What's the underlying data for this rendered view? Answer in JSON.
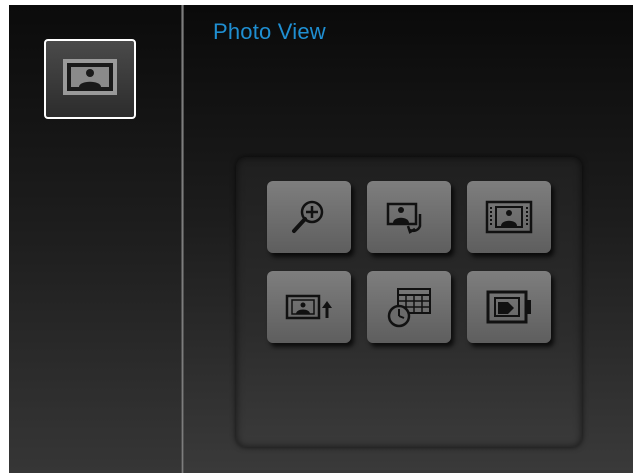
{
  "header": {
    "title": "Photo View"
  },
  "sidebar": {
    "selected_item": "photo-icon"
  },
  "menu": {
    "buttons": [
      {
        "icon": "zoom-icon"
      },
      {
        "icon": "rotate-icon"
      },
      {
        "icon": "fit-to-screen-icon"
      },
      {
        "icon": "slideshow-icon"
      },
      {
        "icon": "calendar-clock-icon"
      },
      {
        "icon": "set-wallpaper-icon"
      }
    ]
  },
  "colors": {
    "title": "#1f8fd2",
    "button": "#6e6e6e",
    "icon": "#111111"
  }
}
